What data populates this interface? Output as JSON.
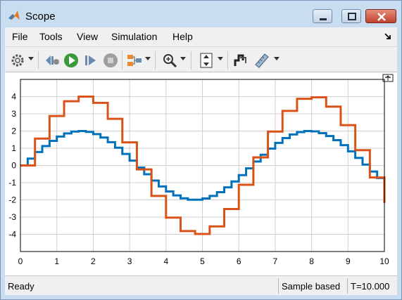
{
  "window": {
    "title": "Scope"
  },
  "menu": [
    "File",
    "Tools",
    "View",
    "Simulation",
    "Help"
  ],
  "toolbar": {
    "buttons": [
      "gear-icon",
      "step-back-icon",
      "run-icon",
      "step-forward-icon",
      "stop-icon",
      "signal-routing-icon",
      "zoom-icon",
      "fit-axes-icon",
      "style-icon",
      "measure-icon"
    ]
  },
  "status": {
    "left": "Ready",
    "mode": "Sample based",
    "time": "T=10.000"
  },
  "colors": {
    "series1": "#0072bd",
    "series2": "#d95319",
    "window": "#c9ddf1"
  },
  "chart_data": {
    "type": "line",
    "step": true,
    "xlim": [
      0,
      10
    ],
    "ylim": [
      -5,
      5
    ],
    "xticks": [
      0,
      1,
      2,
      3,
      4,
      5,
      6,
      7,
      8,
      9,
      10
    ],
    "yticks": [
      -4,
      -3,
      -2,
      -1,
      0,
      1,
      2,
      3,
      4
    ],
    "grid": true,
    "series": [
      {
        "x": [
          0,
          0.2,
          0.4,
          0.6,
          0.8,
          1.0,
          1.2,
          1.4,
          1.6,
          1.8,
          2.0,
          2.2,
          2.4,
          2.6,
          2.8,
          3.0,
          3.2,
          3.4,
          3.6,
          3.8,
          4.0,
          4.2,
          4.4,
          4.6,
          4.8,
          5.0,
          5.2,
          5.4,
          5.6,
          5.8,
          6.0,
          6.2,
          6.4,
          6.6,
          6.8,
          7.0,
          7.2,
          7.4,
          7.6,
          7.8,
          8.0,
          8.2,
          8.4,
          8.6,
          8.8,
          9.0,
          9.2,
          9.4,
          9.6,
          9.8,
          10.0
        ],
        "y": [
          0,
          0.4,
          0.78,
          1.13,
          1.43,
          1.68,
          1.86,
          1.97,
          2.0,
          1.95,
          1.82,
          1.62,
          1.35,
          1.03,
          0.67,
          0.28,
          -0.12,
          -0.51,
          -0.88,
          -1.22,
          -1.51,
          -1.74,
          -1.91,
          -1.99,
          -1.99,
          -1.92,
          -1.77,
          -1.55,
          -1.27,
          -0.93,
          -0.56,
          -0.17,
          0.23,
          0.62,
          0.98,
          1.31,
          1.59,
          1.8,
          1.94,
          2.0,
          1.98,
          1.88,
          1.71,
          1.47,
          1.18,
          0.82,
          0.44,
          0.05,
          -0.35,
          -0.73,
          -1.09
        ]
      },
      {
        "x": [
          0,
          0.4,
          0.8,
          1.2,
          1.6,
          2.0,
          2.4,
          2.8,
          3.2,
          3.6,
          4.0,
          4.4,
          4.8,
          5.2,
          5.6,
          6.0,
          6.4,
          6.8,
          7.2,
          7.6,
          8.0,
          8.4,
          8.8,
          9.2,
          9.6,
          10.0
        ],
        "y": [
          0,
          1.56,
          2.87,
          3.73,
          4.0,
          3.64,
          2.71,
          1.34,
          -0.23,
          -1.77,
          -3.03,
          -3.81,
          -3.98,
          -3.54,
          -2.53,
          -1.12,
          0.47,
          1.97,
          3.17,
          3.87,
          3.96,
          3.42,
          2.34,
          0.89,
          -0.7,
          -2.18
        ]
      }
    ]
  }
}
